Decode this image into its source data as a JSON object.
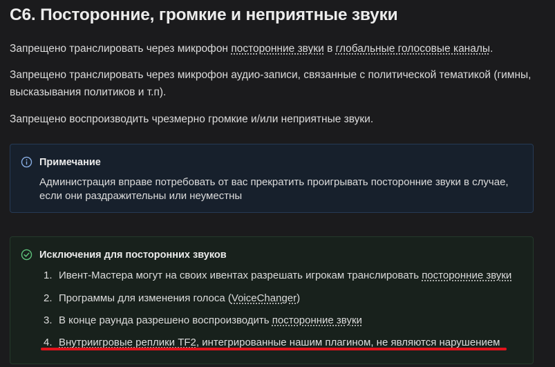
{
  "title": "С6. Посторонние, громкие и неприятные звуки",
  "para1": {
    "before": "Запрещено транслировать через микрофон ",
    "link1": "посторонние звуки",
    "mid": " в ",
    "link2": "глобальные голосовые каналы",
    "after": "."
  },
  "para2": "Запрещено транслировать через микрофон аудио-записи, связанные с политической тематикой (гимны, высказывания политиков и т.п).",
  "para3": "Запрещено воспроизводить чрезмерно громкие и/или неприятные звуки.",
  "note": {
    "icon": "info-icon",
    "title": "Примечание",
    "text": "Администрация вправе потребовать от вас прекратить проигрывать посторонние звуки в случае, если они раздражительны или неуместны"
  },
  "tip": {
    "icon": "check-circle-icon",
    "title": "Исключения для посторонних звуков",
    "items": [
      {
        "num": "1.",
        "before": "Ивент-Мастера могут на своих ивентах разрешать игрокам транслировать ",
        "link": "посторонние звуки",
        "after": ""
      },
      {
        "num": "2.",
        "before": "Программы для изменения голоса (",
        "link": "VoiceChanger",
        "after": ")"
      },
      {
        "num": "3.",
        "before": "В конце раунда разрешено воспроизводить ",
        "link": "посторонние звуки",
        "after": ""
      },
      {
        "num": "4.",
        "before": "",
        "link": "Внутриигровые реплики TF2",
        "after": ", интегрированные нашим плагином, не являются нарушением"
      }
    ]
  },
  "colors": {
    "background": "#1b1b1d",
    "note_bg": "#17202c",
    "note_border": "#263a55",
    "tip_bg": "#18211c",
    "tip_border": "#243a2b",
    "highlight": "#e2131c"
  }
}
